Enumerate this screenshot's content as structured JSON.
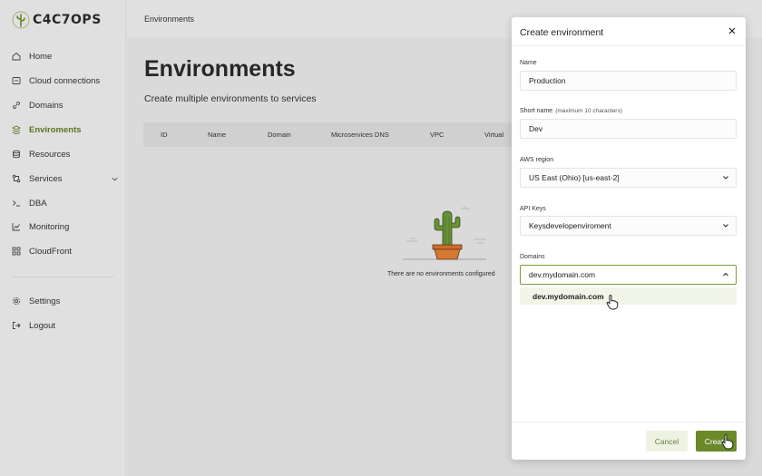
{
  "app": {
    "logo_text": "C4C7OPS"
  },
  "sidebar": {
    "items": [
      {
        "label": "Home",
        "icon": "home-icon"
      },
      {
        "label": "Cloud connections",
        "icon": "cloud-connections-icon"
      },
      {
        "label": "Domains",
        "icon": "link-icon"
      },
      {
        "label": "Enviroments",
        "icon": "layers-icon",
        "active": true
      },
      {
        "label": "Resources",
        "icon": "database-icon"
      },
      {
        "label": "Services",
        "icon": "services-icon",
        "has_submenu": true
      },
      {
        "label": "DBA",
        "icon": "terminal-icon"
      },
      {
        "label": "Monitoring",
        "icon": "chart-icon"
      },
      {
        "label": "CloudFront",
        "icon": "cloudfront-icon"
      }
    ],
    "bottom_items": [
      {
        "label": "Settings",
        "icon": "gear-icon"
      },
      {
        "label": "Logout",
        "icon": "logout-icon"
      }
    ]
  },
  "topbar": {
    "title": "Environments"
  },
  "main": {
    "title": "Environments",
    "subtitle": "Create multiple environments to services",
    "table_columns": [
      "ID",
      "Name",
      "Domain",
      "Microservices DNS",
      "VPC",
      "Virtual"
    ],
    "empty_text": "There are no environments configured"
  },
  "modal": {
    "title": "Create environment",
    "fields": {
      "name": {
        "label": "Name",
        "value": "Production"
      },
      "short_name": {
        "label": "Short name",
        "hint": "(maximum 10 characters)",
        "value": "Dev"
      },
      "aws_region": {
        "label": "AWS region",
        "value": "US East (Ohio) [us-east-2]"
      },
      "api_keys": {
        "label": "API Keys",
        "value": "Keysdevelopenviroment"
      },
      "domains": {
        "label": "Domains",
        "value": "dev.mydomain.com",
        "options": [
          "dev.mydomain.com"
        ]
      }
    },
    "cancel_label": "Cancel",
    "create_label": "Create"
  },
  "colors": {
    "accent": "#6a8a2a",
    "active_nav": "#5e7d22"
  }
}
